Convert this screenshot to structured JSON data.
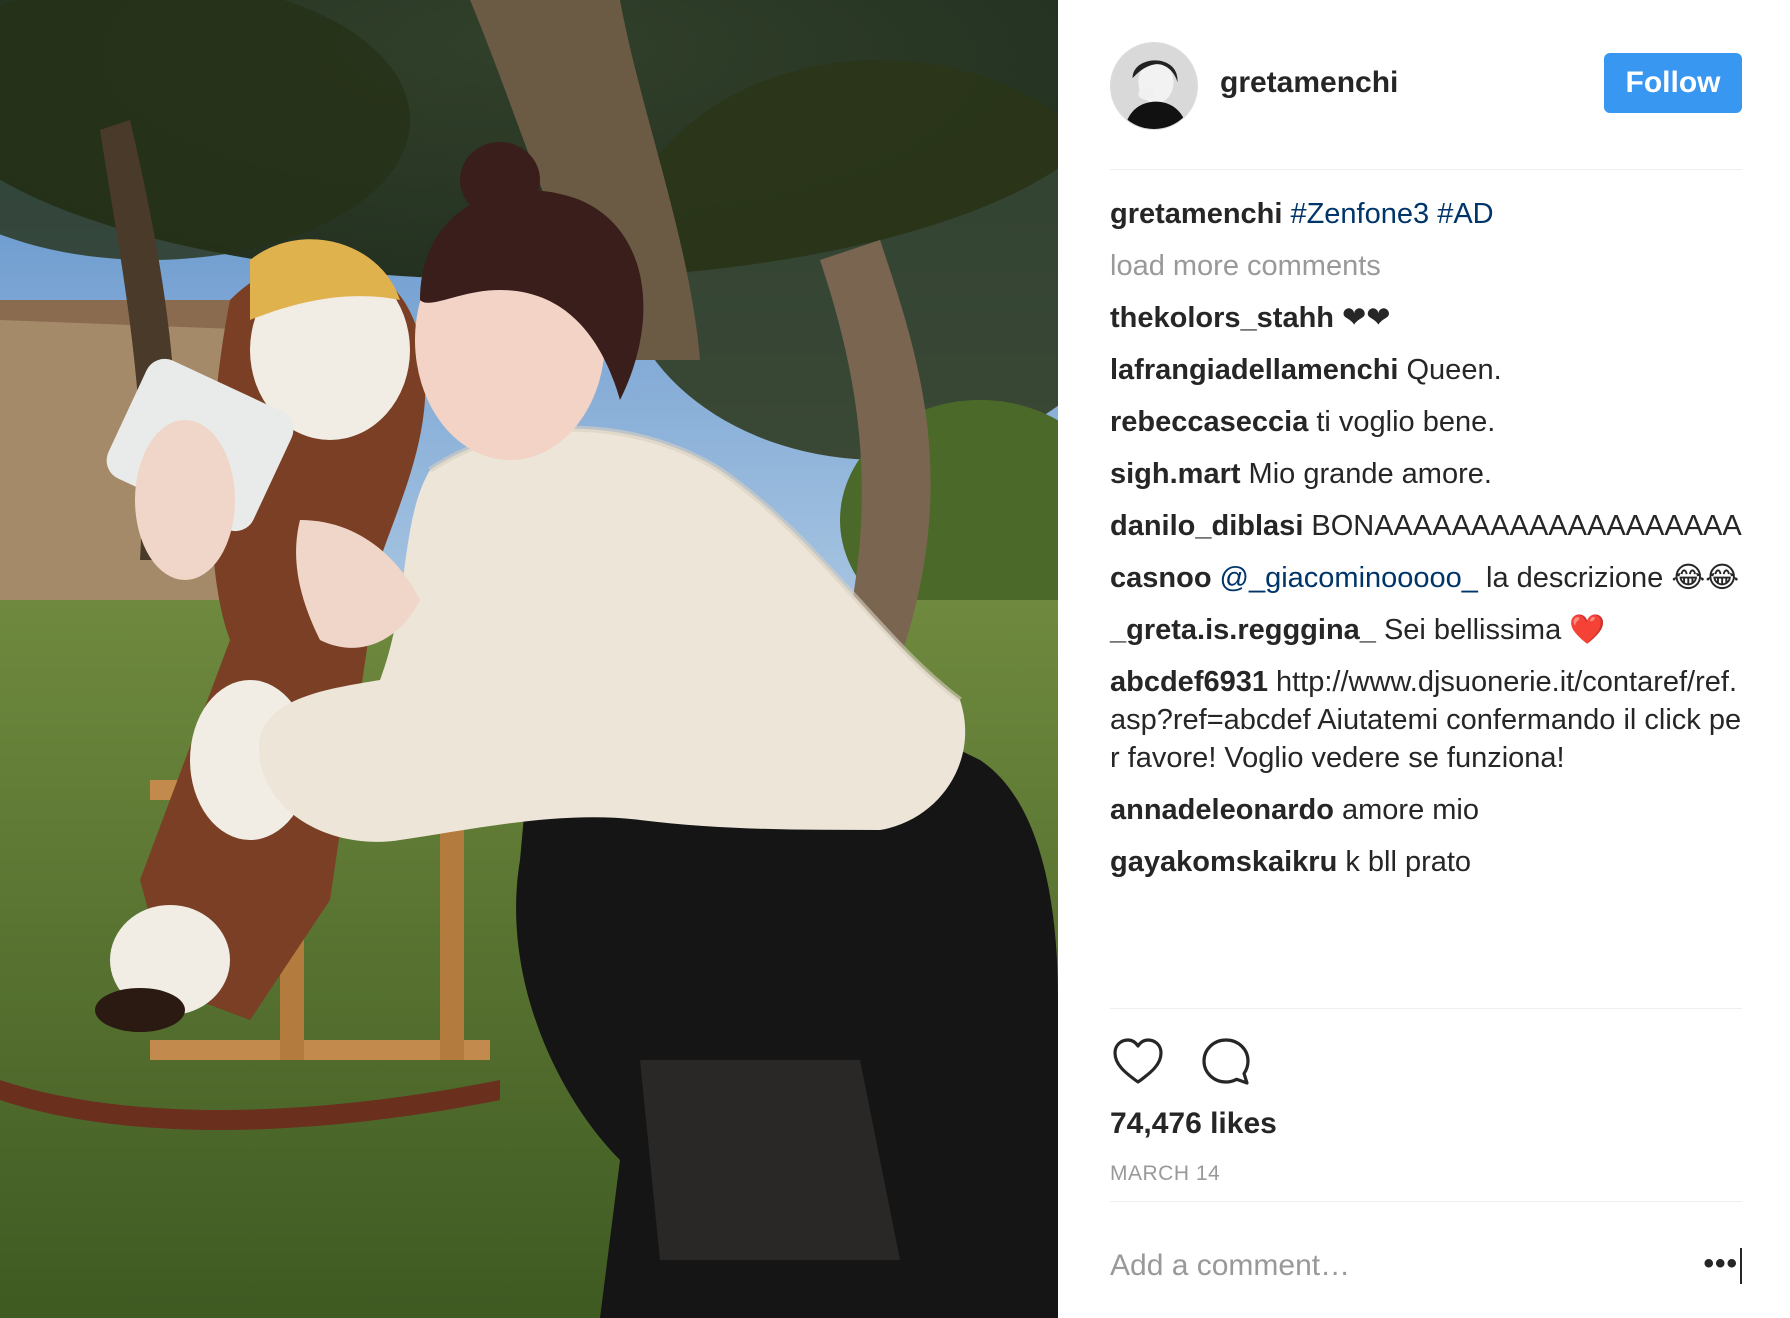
{
  "post": {
    "username": "gretamenchi",
    "follow_label": "Follow",
    "caption": {
      "user": "gretamenchi",
      "tags": [
        "#Zenfone3",
        "#AD"
      ]
    },
    "load_more_label": "load more comments",
    "comments": [
      {
        "user": "thekolors_stahh",
        "text": "❤❤"
      },
      {
        "user": "lafrangiadellamenchi",
        "text": "Queen."
      },
      {
        "user": "rebeccaseccia",
        "text": "ti voglio bene."
      },
      {
        "user": "sigh.mart",
        "text": "Mio grande amore."
      },
      {
        "user": "danilo_diblasi",
        "text": "BONAAAAAAAAAAAAAAAAAAA"
      },
      {
        "user": "casnoo",
        "mention": "@_giacominooooo_",
        "text": "la descrizione 😂😂"
      },
      {
        "user": "_greta.is.regggina_",
        "text": "Sei bellissima",
        "emoji": "❤️"
      },
      {
        "user": "abcdef6931",
        "text": "http://www.djsuonerie.it/contaref/ref.asp?ref=abcdef Aiutatemi confermando il click per favore! Voglio vedere se funziona!"
      },
      {
        "user": "annadeleonardo",
        "text": "amore mio"
      },
      {
        "user": "gayakomskaikru",
        "text": "k bll prato"
      }
    ],
    "likes_label": "74,476 likes",
    "date": "MARCH 14",
    "comment_placeholder": "Add a comment…",
    "more_label": "•••"
  },
  "icons": {
    "like": "heart-icon",
    "comment": "comment-bubble-icon",
    "more": "more-options-icon"
  },
  "colors": {
    "follow_bg": "#3897f0",
    "hashtag": "#003569",
    "muted": "#999999",
    "heart_emoji": "#ed4956"
  }
}
